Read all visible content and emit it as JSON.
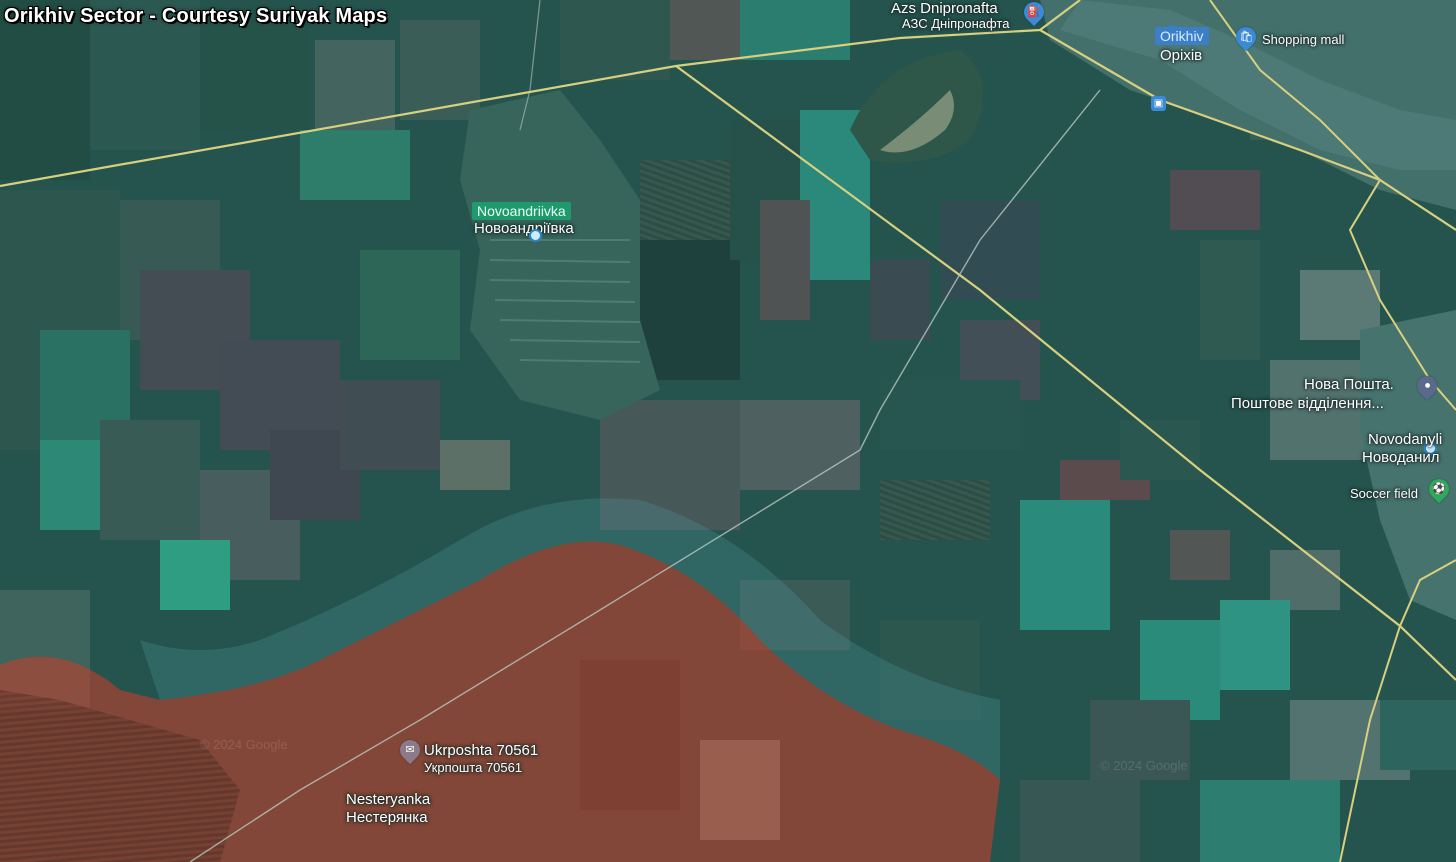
{
  "title": "Orikhiv Sector - Courtesy Suriyak Maps",
  "colors": {
    "field_base": "#23463f",
    "road": "#d8d07e",
    "ukr_overlay": "#2e8a83",
    "rus_overlay": "#c2402a",
    "google_highlight": "#1e9a6c",
    "poi_blue": "#2f84c8",
    "poi_green": "#2eaa5a"
  },
  "places": {
    "novoandriivka": {
      "latin": "Novoandriivka",
      "cyrillic": "Новоандріївка"
    },
    "orikhiv": {
      "latin": "Orikhiv",
      "cyrillic": "Оріхів"
    },
    "nesteryanka": {
      "latin": "Nesteryanka",
      "cyrillic": "Нестерянка"
    },
    "novodanylivka": {
      "latin": "Novodanyli",
      "cyrillic": "Новоданил"
    }
  },
  "pois": {
    "gas_station": {
      "latin": "Azs Dnipronafta",
      "cyrillic": "АЗС Дніпронафта",
      "icon": "fuel-icon"
    },
    "shopping_mall": {
      "label": "Shopping mall",
      "icon": "shopping-bag-icon"
    },
    "nova_poshta": {
      "line1": "Нова Пошта.",
      "line2": "Поштове відділення...",
      "icon": "pin-icon"
    },
    "soccer_field": {
      "label": "Soccer field",
      "icon": "soccer-pin-icon"
    },
    "ukrposhta": {
      "latin": "Ukrposhta 70561",
      "cyrillic": "Укрпошта 70561",
      "icon": "mail-icon"
    },
    "train": {
      "icon": "train-icon"
    }
  },
  "watermarks": [
    "© 2024 Google",
    "© 2024 Google"
  ]
}
